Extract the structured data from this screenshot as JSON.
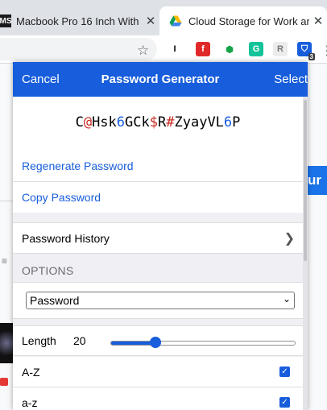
{
  "browser": {
    "tabs": [
      {
        "favicon": "MS",
        "title": "Macbook Pro 16 Inch With",
        "close": "✕"
      },
      {
        "title": "Cloud Storage for Work an",
        "close": "✕"
      }
    ],
    "extensions": [
      {
        "name": "instapaper-icon",
        "glyph": "I",
        "bg": "#ffffff",
        "fg": "#000000"
      },
      {
        "name": "flipboard-icon",
        "glyph": "f",
        "bg": "#e12828",
        "fg": "#ffffff"
      },
      {
        "name": "share-extension-icon",
        "glyph": "⬢",
        "bg": "#ffffff",
        "fg": "#16a34a"
      },
      {
        "name": "grammarly-icon",
        "glyph": "G",
        "bg": "#15c39a",
        "fg": "#ffffff"
      },
      {
        "name": "readwise-icon",
        "glyph": "R",
        "bg": "#ececec",
        "fg": "#777777"
      },
      {
        "name": "bitwarden-icon",
        "glyph": "⛉",
        "bg": "#175ddc",
        "fg": "#ffffff",
        "badge": "3"
      }
    ],
    "more": "⋮",
    "star": "☆"
  },
  "background_page": {
    "button_fragment": "ur"
  },
  "popup": {
    "header": {
      "cancel": "Cancel",
      "title": "Password Generator",
      "select": "Select"
    },
    "password": [
      {
        "t": "C",
        "k": "l"
      },
      {
        "t": "@",
        "k": "s"
      },
      {
        "t": "Hsk",
        "k": "l"
      },
      {
        "t": "6",
        "k": "n"
      },
      {
        "t": "GCk",
        "k": "l"
      },
      {
        "t": "$",
        "k": "s"
      },
      {
        "t": "R",
        "k": "l"
      },
      {
        "t": "#",
        "k": "s"
      },
      {
        "t": "ZyayVL",
        "k": "l"
      },
      {
        "t": "6",
        "k": "n"
      },
      {
        "t": "P",
        "k": "l"
      }
    ],
    "regenerate": "Regenerate Password",
    "copy": "Copy Password",
    "history": "Password History",
    "history_chevron": "❯",
    "options_label": "OPTIONS",
    "type_select": {
      "value": "Password",
      "chevron": "⌄"
    },
    "length": {
      "label": "Length",
      "value": "20",
      "min": 5,
      "max": 128,
      "current": 20
    },
    "checks": [
      {
        "label": "A-Z",
        "checked": true
      },
      {
        "label": "a-z",
        "checked": true
      }
    ],
    "check_glyph": "✓"
  },
  "colors": {
    "accent": "#175ddc",
    "number": "#175ddc",
    "special": "#c7281f"
  }
}
